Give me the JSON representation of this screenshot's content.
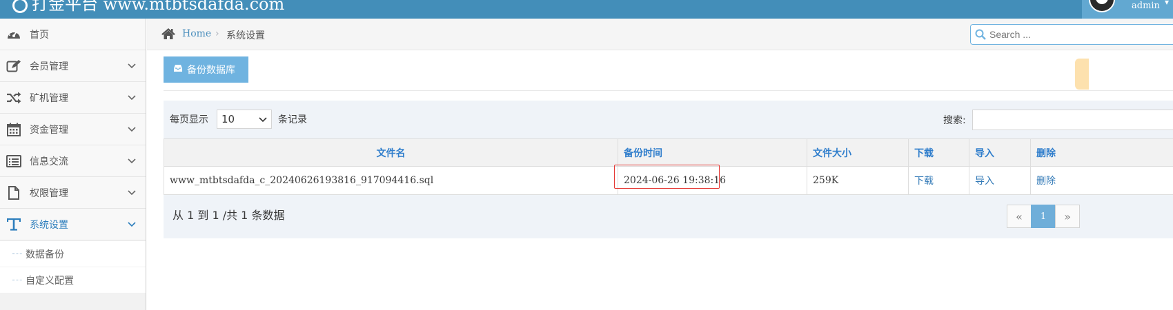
{
  "header": {
    "brand": "打金平台 www.mtbtsdafda.com",
    "username": "admin"
  },
  "sidebar": {
    "items": [
      {
        "label": "首页",
        "icon": "dashboard-icon"
      },
      {
        "label": "会员管理",
        "icon": "edit-icon"
      },
      {
        "label": "矿机管理",
        "icon": "shuffle-icon"
      },
      {
        "label": "资金管理",
        "icon": "calendar-icon"
      },
      {
        "label": "信息交流",
        "icon": "list-icon"
      },
      {
        "label": "权限管理",
        "icon": "file-icon"
      },
      {
        "label": "系统设置",
        "icon": "text-icon",
        "active": true
      }
    ],
    "submenu": [
      {
        "label": "数据备份"
      },
      {
        "label": "自定义配置"
      }
    ]
  },
  "breadcrumbs": {
    "home": "Home",
    "current": "系统设置"
  },
  "search": {
    "placeholder": "Search ..."
  },
  "toolbar": {
    "backup_label": "备份数据库"
  },
  "table_controls": {
    "page_size_label": "每页显示",
    "page_size_value": "10",
    "records_label": "条记录",
    "search_label": "搜索:"
  },
  "table": {
    "columns": [
      "文件名",
      "备份时间",
      "文件大小",
      "下载",
      "导入",
      "删除"
    ],
    "rows": [
      {
        "filename": "www_mtbtsdafda_c_20240626193816_917094416.sql",
        "backup_time": "2024-06-26 19:38:16",
        "size": "259K",
        "download": "下载",
        "import": "导入",
        "delete": "删除"
      }
    ]
  },
  "footer": {
    "summary": "从 1 到 1 /共 1 条数据",
    "pagination": {
      "prev": "«",
      "current": "1",
      "next": "»"
    }
  },
  "colors": {
    "topbar": "#438eb9",
    "accent": "#307ecc",
    "button": "#6fb3e0",
    "highlight": "#e53935"
  }
}
